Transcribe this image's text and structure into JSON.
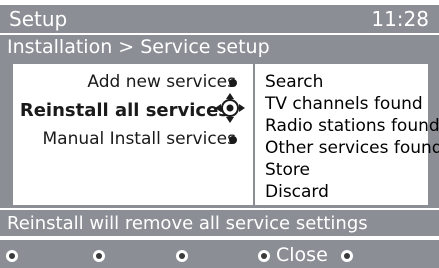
{
  "header": {
    "title": "Setup",
    "clock": "11:28"
  },
  "breadcrumb": "Installation > Service setup",
  "menu": {
    "items": [
      {
        "label": "Add new services",
        "selected": false
      },
      {
        "label": "Reinstall all services",
        "selected": true
      },
      {
        "label": "Manual Install services",
        "selected": false
      }
    ]
  },
  "options": [
    "Search",
    "TV channels found",
    "Radio stations found",
    "Other services found",
    "Store",
    "Discard"
  ],
  "info": "Reinstall will remove all service settings",
  "softkeys": [
    "",
    "",
    "",
    "Close",
    ""
  ],
  "colors": {
    "bar_gray": "#8b8f95",
    "panel_white": "#ffffff",
    "text_dark": "#1a1a1a"
  }
}
